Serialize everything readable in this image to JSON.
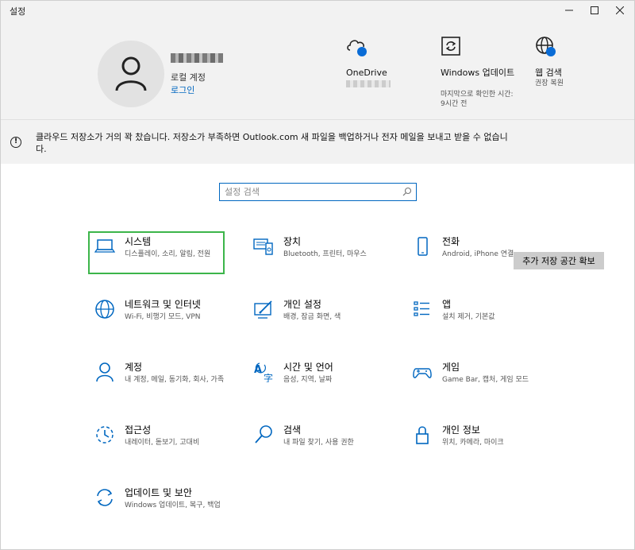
{
  "window": {
    "title": "설정"
  },
  "header": {
    "account_type": "로컬 계정",
    "login_link": "로그인",
    "items": [
      {
        "label": "OneDrive",
        "icon": "onedrive-cloud-icon"
      },
      {
        "label": "Windows 업데이트",
        "sub": "마지막으로 확인한 시간: 9시간 전",
        "icon": "windows-update-icon"
      },
      {
        "label": "웹 검색",
        "sub": "권장 복원",
        "icon": "web-search-globe-icon"
      }
    ]
  },
  "banner": {
    "message": "클라우드 저장소가 거의 꽉 찼습니다. 저장소가 부족하면 Outlook.com 새 파일을 백업하거나 전자 메일을 보내고 받을 수 없습니다.",
    "button": "추가 저장 공간 확보"
  },
  "search": {
    "placeholder": "설정 검색"
  },
  "tiles": [
    {
      "name": "시스템",
      "desc": "디스플레이, 소리, 알림, 전원"
    },
    {
      "name": "장치",
      "desc": "Bluetooth, 프린터, 마우스"
    },
    {
      "name": "전화",
      "desc": "Android, iPhone 연결"
    },
    {
      "name": "네트워크 및 인터넷",
      "desc": "Wi-Fi, 비행기 모드, VPN"
    },
    {
      "name": "개인 설정",
      "desc": "배경, 잠금 화면, 색"
    },
    {
      "name": "앱",
      "desc": "설치 제거, 기본값"
    },
    {
      "name": "계정",
      "desc": "내 계정, 메일, 동기화, 회사, 가족"
    },
    {
      "name": "시간 및 언어",
      "desc": "음성, 지역, 날짜"
    },
    {
      "name": "게임",
      "desc": "Game Bar, 캡처, 게임 모드"
    },
    {
      "name": "접근성",
      "desc": "내레이터, 돋보기, 고대비"
    },
    {
      "name": "검색",
      "desc": "내 파일 찾기, 사용 권한"
    },
    {
      "name": "개인 정보",
      "desc": "위치, 카메라, 마이크"
    },
    {
      "name": "업데이트 및 보안",
      "desc": "Windows 업데이트, 복구, 백업"
    }
  ],
  "colors": {
    "accent": "#0067c0",
    "selected_outline": "#3cb54a",
    "header_bg": "#f2f2f2",
    "badge": "#0a6cd6"
  }
}
